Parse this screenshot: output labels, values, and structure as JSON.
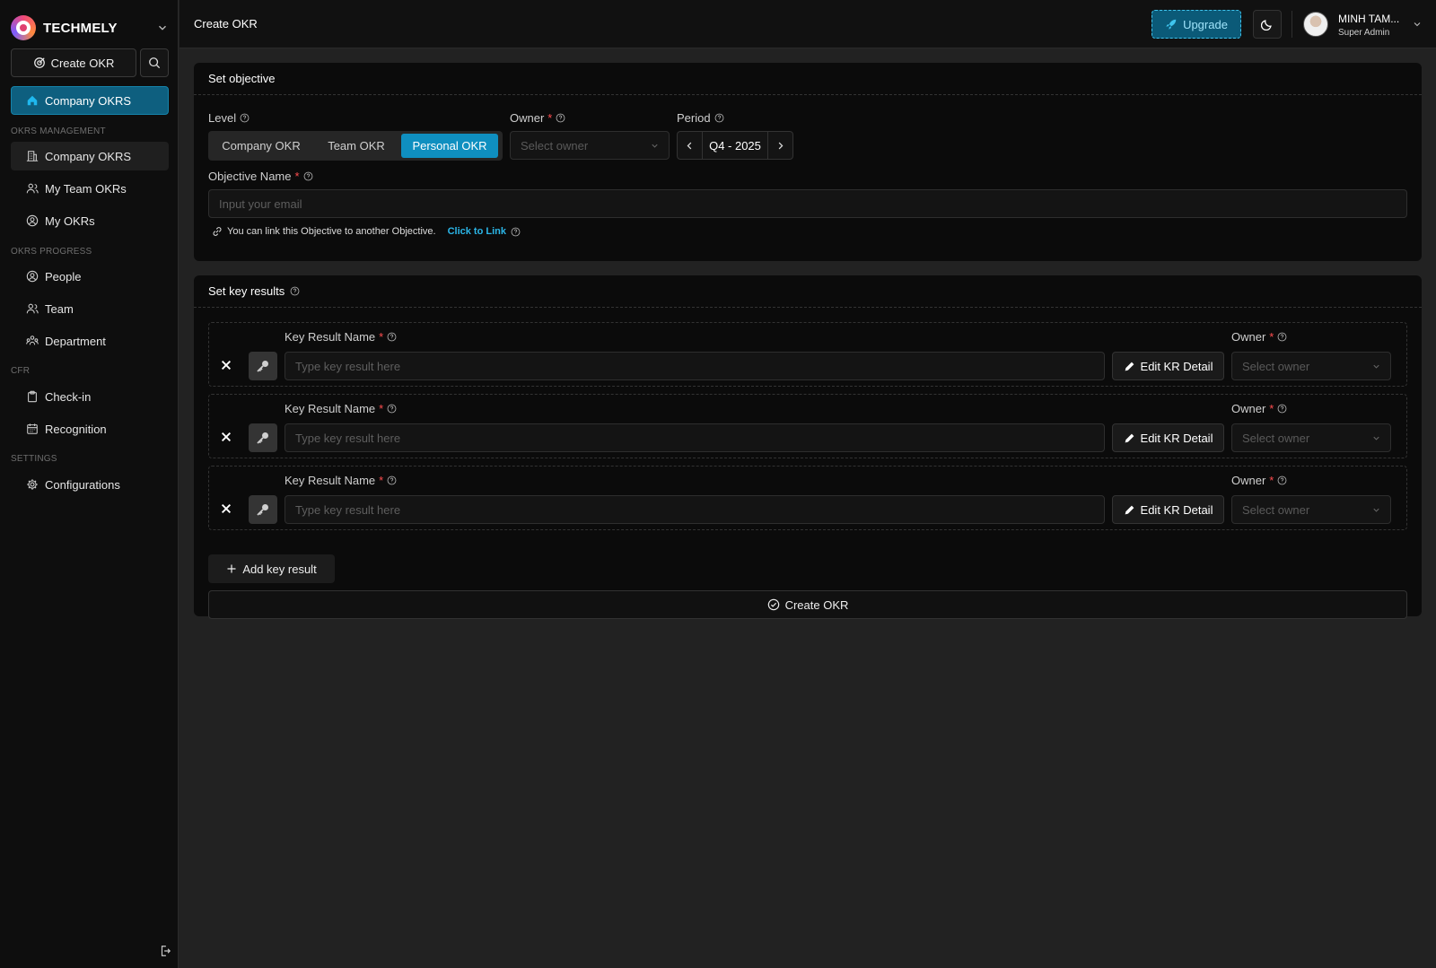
{
  "brand": {
    "name": "TECHMELY"
  },
  "sidebar": {
    "create_label": "Create OKR",
    "active_item": "Company OKRS",
    "sections": [
      {
        "title": "OKRS MANAGEMENT",
        "items": [
          "Company OKRS",
          "My Team OKRs",
          "My OKRs"
        ]
      },
      {
        "title": "OKRS PROGRESS",
        "items": [
          "People",
          "Team",
          "Department"
        ]
      },
      {
        "title": "CFR",
        "items": [
          "Check-in",
          "Recognition"
        ]
      },
      {
        "title": "SETTINGS",
        "items": [
          "Configurations"
        ]
      }
    ]
  },
  "header": {
    "title": "Create OKR",
    "upgrade_label": "Upgrade",
    "user_name": "MINH TAM...",
    "user_role": "Super Admin"
  },
  "objective": {
    "title": "Set objective",
    "level_label": "Level",
    "levels": [
      "Company OKR",
      "Team OKR",
      "Personal OKR"
    ],
    "selected_level": "Personal OKR",
    "owner_label": "Owner",
    "owner_placeholder": "Select owner",
    "period_label": "Period",
    "period_value": "Q4 - 2025",
    "name_label": "Objective Name",
    "name_placeholder": "Input your email",
    "link_note": "You can link this Objective to another Objective.",
    "link_action": "Click to Link"
  },
  "key_results": {
    "title": "Set key results",
    "items": [
      {
        "name_label": "Key Result Name",
        "placeholder": "Type key result here",
        "edit_label": "Edit KR Detail",
        "owner_label": "Owner",
        "owner_placeholder": "Select owner"
      },
      {
        "name_label": "Key Result Name",
        "placeholder": "Type key result here",
        "edit_label": "Edit KR Detail",
        "owner_label": "Owner",
        "owner_placeholder": "Select owner"
      },
      {
        "name_label": "Key Result Name",
        "placeholder": "Type key result here",
        "edit_label": "Edit KR Detail",
        "owner_label": "Owner",
        "owner_placeholder": "Select owner"
      }
    ],
    "add_label": "Add key result",
    "submit_label": "Create OKR"
  },
  "colors": {
    "accent": "#0f8fc0",
    "required": "#ff4d4f",
    "link": "#2bb6e8"
  }
}
